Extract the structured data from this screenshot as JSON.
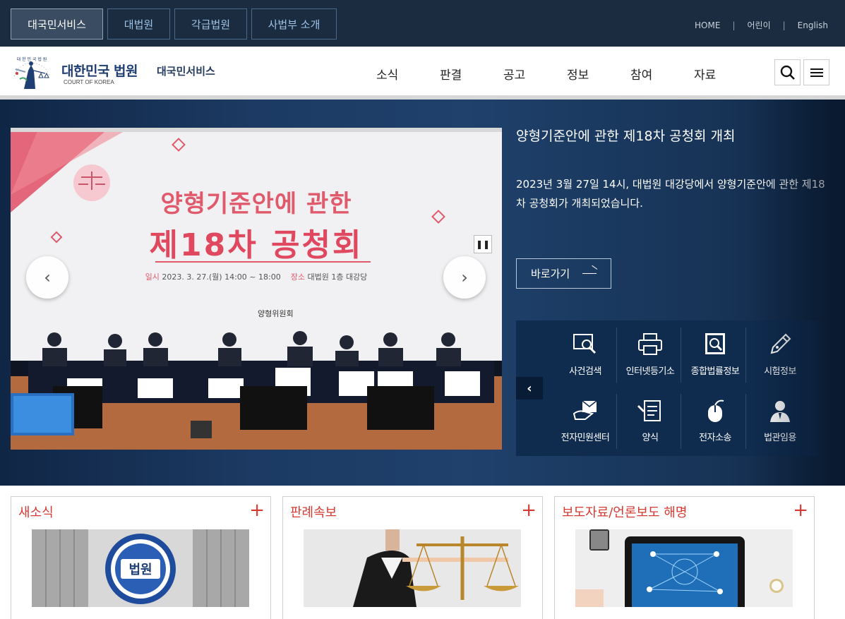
{
  "topbar": {
    "tabs": [
      {
        "label": "대국민서비스",
        "active": true
      },
      {
        "label": "대법원",
        "active": false
      },
      {
        "label": "각급법원",
        "active": false
      },
      {
        "label": "사법부 소개",
        "active": false
      }
    ],
    "links": [
      "HOME",
      "어린이",
      "English"
    ]
  },
  "header": {
    "logo_name": "대한민국 법원",
    "logo_sub": "COURT OF KOREA",
    "service": "대국민서비스",
    "emblem_text": "대 한 민 국 법 원",
    "nav": [
      "소식",
      "판결",
      "공고",
      "정보",
      "참여",
      "자료"
    ]
  },
  "hero": {
    "slide": {
      "title1": "양형기준안에 관한",
      "title2": "제18차 공청회",
      "date_label": "일시",
      "date": "2023. 3. 27.(월) 14:00 ~ 18:00",
      "place_label": "장소",
      "place": "대법원 1층 대강당",
      "org": "양형위원회"
    },
    "headline": "양형기준안에 관한 제18차 공청회 개최",
    "description": "2023년 3월 27일 14시, 대법원 대강당에서 양형기준안에 관한 제18차 공청회가 개최되었습니다.",
    "goto_label": "바로가기",
    "quick_links": [
      {
        "label": "사건검색",
        "icon": "case-search-icon"
      },
      {
        "label": "인터넷등기소",
        "icon": "printer-icon"
      },
      {
        "label": "종합법률정보",
        "icon": "legal-info-icon"
      },
      {
        "label": "시험정보",
        "icon": "pen-icon"
      },
      {
        "label": "전자민원센터",
        "icon": "hand-mail-icon"
      },
      {
        "label": "양식",
        "icon": "form-icon"
      },
      {
        "label": "전자소송",
        "icon": "mouse-icon"
      },
      {
        "label": "법관임용",
        "icon": "judge-icon"
      }
    ]
  },
  "cards": [
    {
      "title": "새소식",
      "thumb": "court-emblem-building"
    },
    {
      "title": "판례속보",
      "thumb": "scales-of-justice"
    },
    {
      "title": "보도자료/언론보도 해명",
      "thumb": "tablet-network"
    }
  ],
  "colors": {
    "topbar_bg": "#1b2c40",
    "hero_bg": "#1c3a63",
    "quick_bg": "#0f2b4e",
    "accent_red": "#d63a33",
    "logo_navy": "#1f3e73"
  }
}
